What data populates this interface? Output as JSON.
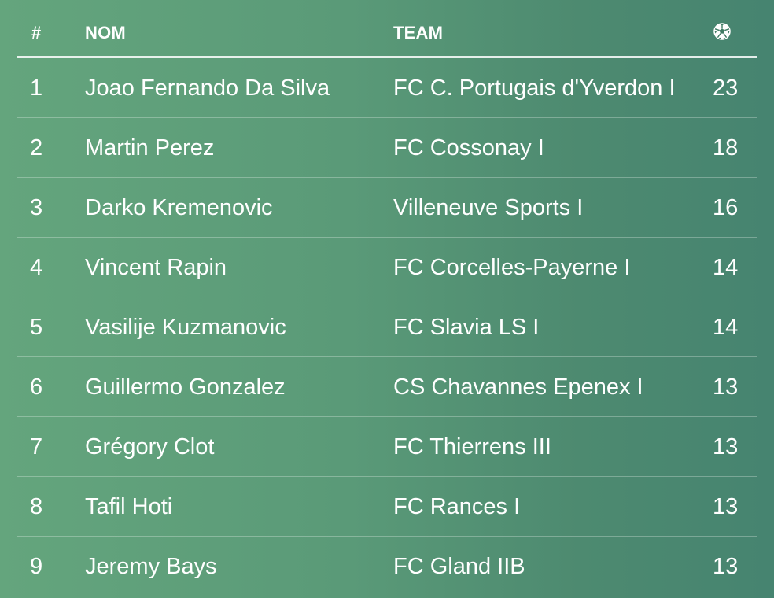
{
  "header": {
    "rank_label": "#",
    "name_label": "NOM",
    "team_label": "TEAM",
    "goals_icon": "soccer-ball-icon"
  },
  "rows": [
    {
      "rank": "1",
      "name": "Joao Fernando Da Silva",
      "team": "FC C. Portugais d'Yverdon I",
      "goals": "23"
    },
    {
      "rank": "2",
      "name": "Martin Perez",
      "team": "FC Cossonay I",
      "goals": "18"
    },
    {
      "rank": "3",
      "name": "Darko Kremenovic",
      "team": "Villeneuve Sports I",
      "goals": "16"
    },
    {
      "rank": "4",
      "name": "Vincent Rapin",
      "team": "FC Corcelles-Payerne I",
      "goals": "14"
    },
    {
      "rank": "5",
      "name": "Vasilije Kuzmanovic",
      "team": "FC Slavia LS I",
      "goals": "14"
    },
    {
      "rank": "6",
      "name": "Guillermo Gonzalez",
      "team": "CS Chavannes Epenex I",
      "goals": "13"
    },
    {
      "rank": "7",
      "name": "Grégory Clot",
      "team": "FC Thierrens III",
      "goals": "13"
    },
    {
      "rank": "8",
      "name": "Tafil Hoti",
      "team": "FC Rances I",
      "goals": "13"
    },
    {
      "rank": "9",
      "name": "Jeremy Bays",
      "team": "FC Gland IIB",
      "goals": "13"
    }
  ],
  "colors": {
    "background_start": "#64a57d",
    "background_end": "#468470",
    "text": "#ffffff"
  }
}
